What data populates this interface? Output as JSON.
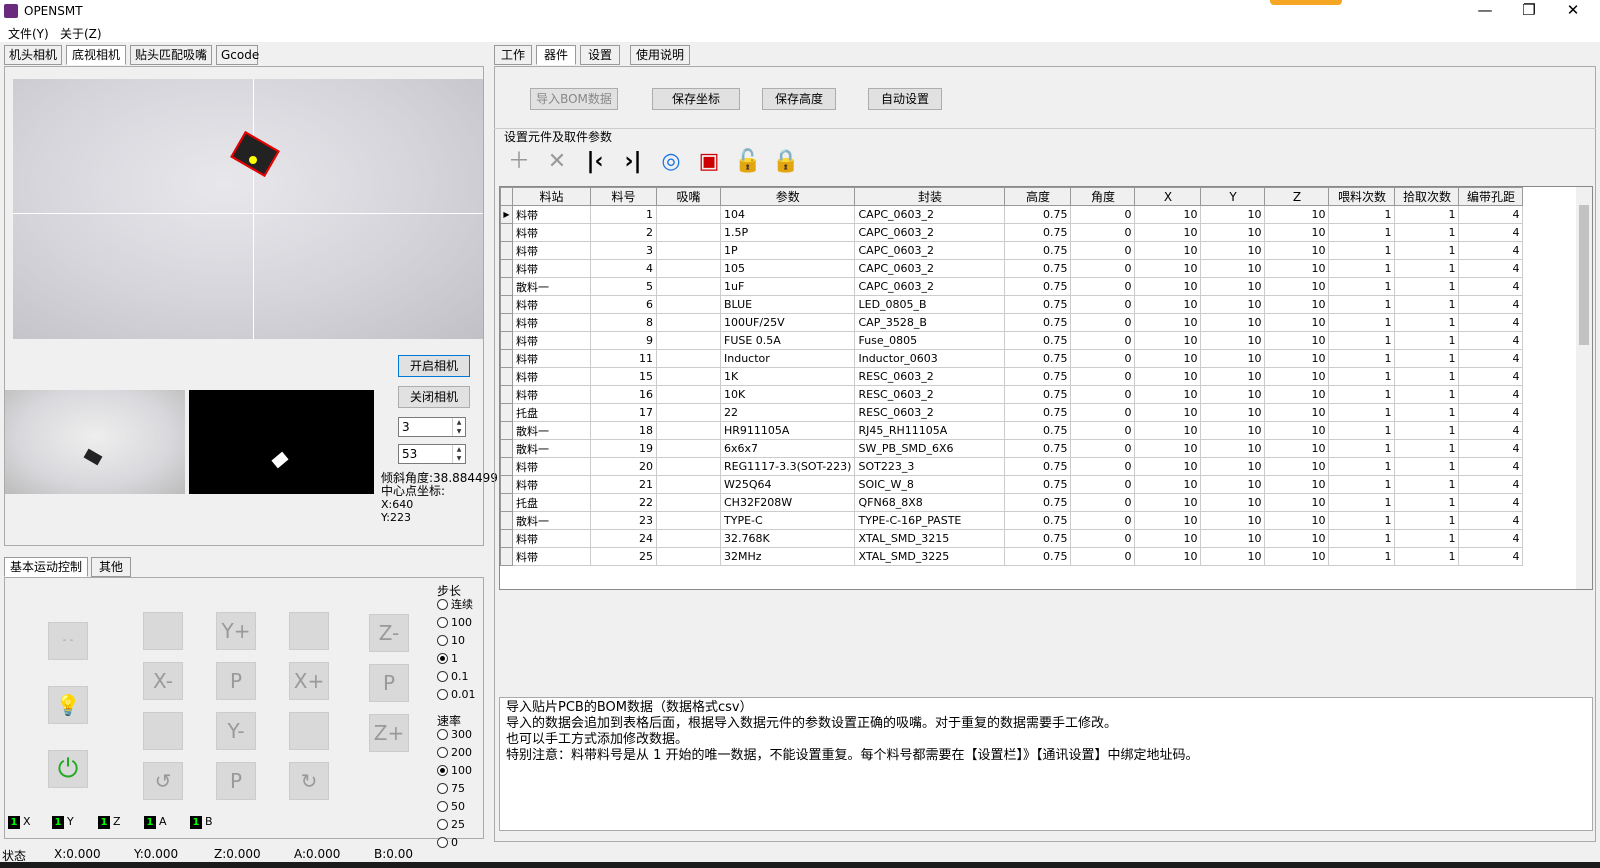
{
  "window": {
    "title": "OPENSMT",
    "minimize": "—",
    "maximize": "❐",
    "close": "✕"
  },
  "menu": [
    "文件(Y)",
    "关于(Z)"
  ],
  "left_tabs": [
    "机头相机",
    "底视相机",
    "贴头匹配吸嘴",
    "Gcode"
  ],
  "camera": {
    "open_label": "开启相机",
    "close_label": "关闭相机",
    "spin1": "3",
    "spin2": "53",
    "angle": "倾斜角度:38.884499",
    "center_label": "中心点坐标:",
    "x": "X:640",
    "y": "Y:223"
  },
  "control_tabs": [
    "基本运动控制",
    "其他"
  ],
  "jog": {
    "y_plus": "Y+",
    "y_minus": "Y-",
    "x_plus": "X+",
    "x_minus": "X-",
    "p": "P",
    "z_plus": "Z+",
    "z_minus": "Z-",
    "blank": "- -"
  },
  "step": {
    "label": "步长",
    "options": [
      "连续",
      "100",
      "10",
      "1",
      "0.1",
      "0.01"
    ],
    "selected": "1"
  },
  "speed": {
    "label": "速率",
    "options": [
      "300",
      "200",
      "100",
      "75",
      "50",
      "25",
      "0"
    ],
    "selected": "100"
  },
  "axes": [
    "X",
    "Y",
    "Z",
    "A",
    "B"
  ],
  "status": {
    "label": "状态",
    "x": "X:0.000",
    "y": "Y:0.000",
    "z": "Z:0.000",
    "a": "A:0.000",
    "b": "B:0.00"
  },
  "right_tabs": [
    "工作",
    "器件",
    "设置",
    "使用说明"
  ],
  "toolbar": {
    "import": "导入BOM数据",
    "save_coord": "保存坐标",
    "save_height": "保存高度",
    "auto_set": "自动设置"
  },
  "section_label": "设置元件及取件参数",
  "table": {
    "headers": [
      "料站",
      "料号",
      "吸嘴",
      "参数",
      "封装",
      "高度",
      "角度",
      "X",
      "Y",
      "Z",
      "喂料次数",
      "拾取次数",
      "编带孔距"
    ],
    "rows": [
      [
        "料带",
        "1",
        "",
        "104",
        "CAPC_0603_2",
        "0.75",
        "0",
        "10",
        "10",
        "10",
        "1",
        "1",
        "4"
      ],
      [
        "料带",
        "2",
        "",
        "1.5P",
        "CAPC_0603_2",
        "0.75",
        "0",
        "10",
        "10",
        "10",
        "1",
        "1",
        "4"
      ],
      [
        "料带",
        "3",
        "",
        "1P",
        "CAPC_0603_2",
        "0.75",
        "0",
        "10",
        "10",
        "10",
        "1",
        "1",
        "4"
      ],
      [
        "料带",
        "4",
        "",
        "105",
        "CAPC_0603_2",
        "0.75",
        "0",
        "10",
        "10",
        "10",
        "1",
        "1",
        "4"
      ],
      [
        "散料一",
        "5",
        "",
        "1uF",
        "CAPC_0603_2",
        "0.75",
        "0",
        "10",
        "10",
        "10",
        "1",
        "1",
        "4"
      ],
      [
        "料带",
        "6",
        "",
        "BLUE",
        "LED_0805_B",
        "0.75",
        "0",
        "10",
        "10",
        "10",
        "1",
        "1",
        "4"
      ],
      [
        "料带",
        "8",
        "",
        "100UF/25V",
        "CAP_3528_B",
        "0.75",
        "0",
        "10",
        "10",
        "10",
        "1",
        "1",
        "4"
      ],
      [
        "料带",
        "9",
        "",
        "FUSE 0.5A",
        "Fuse_0805",
        "0.75",
        "0",
        "10",
        "10",
        "10",
        "1",
        "1",
        "4"
      ],
      [
        "料带",
        "11",
        "",
        "Inductor",
        "Inductor_0603",
        "0.75",
        "0",
        "10",
        "10",
        "10",
        "1",
        "1",
        "4"
      ],
      [
        "料带",
        "15",
        "",
        "1K",
        "RESC_0603_2",
        "0.75",
        "0",
        "10",
        "10",
        "10",
        "1",
        "1",
        "4"
      ],
      [
        "料带",
        "16",
        "",
        "10K",
        "RESC_0603_2",
        "0.75",
        "0",
        "10",
        "10",
        "10",
        "1",
        "1",
        "4"
      ],
      [
        "托盘",
        "17",
        "",
        "22",
        "RESC_0603_2",
        "0.75",
        "0",
        "10",
        "10",
        "10",
        "1",
        "1",
        "4"
      ],
      [
        "散料一",
        "18",
        "",
        "HR911105A",
        "RJ45_RH11105A",
        "0.75",
        "0",
        "10",
        "10",
        "10",
        "1",
        "1",
        "4"
      ],
      [
        "散料一",
        "19",
        "",
        "6x6x7",
        "SW_PB_SMD_6X6",
        "0.75",
        "0",
        "10",
        "10",
        "10",
        "1",
        "1",
        "4"
      ],
      [
        "料带",
        "20",
        "",
        "REG1117-3.3(SOT-223)",
        "SOT223_3",
        "0.75",
        "0",
        "10",
        "10",
        "10",
        "1",
        "1",
        "4"
      ],
      [
        "料带",
        "21",
        "",
        "W25Q64",
        "SOIC_W_8",
        "0.75",
        "0",
        "10",
        "10",
        "10",
        "1",
        "1",
        "4"
      ],
      [
        "托盘",
        "22",
        "",
        "CH32F208W",
        "QFN68_8X8",
        "0.75",
        "0",
        "10",
        "10",
        "10",
        "1",
        "1",
        "4"
      ],
      [
        "散料一",
        "23",
        "",
        "TYPE-C",
        "TYPE-C-16P_PASTE",
        "0.75",
        "0",
        "10",
        "10",
        "10",
        "1",
        "1",
        "4"
      ],
      [
        "料带",
        "24",
        "",
        "32.768K",
        "XTAL_SMD_3215",
        "0.75",
        "0",
        "10",
        "10",
        "10",
        "1",
        "1",
        "4"
      ],
      [
        "料带",
        "25",
        "",
        "32MHz",
        "XTAL_SMD_3225",
        "0.75",
        "0",
        "10",
        "10",
        "10",
        "1",
        "1",
        "4"
      ]
    ]
  },
  "description": [
    "导入贴片PCB的BOM数据（数据格式csv）",
    "导入的数据会追加到表格后面，根据导入数据元件的参数设置正确的吸嘴。对于重复的数据需要手工修改。",
    "也可以手工方式添加修改数据。",
    "特别注意：料带料号是从 1 开始的唯一数据，不能设置重复。每个料号都需要在【设置栏】》【通讯设置】中绑定地址码。"
  ]
}
